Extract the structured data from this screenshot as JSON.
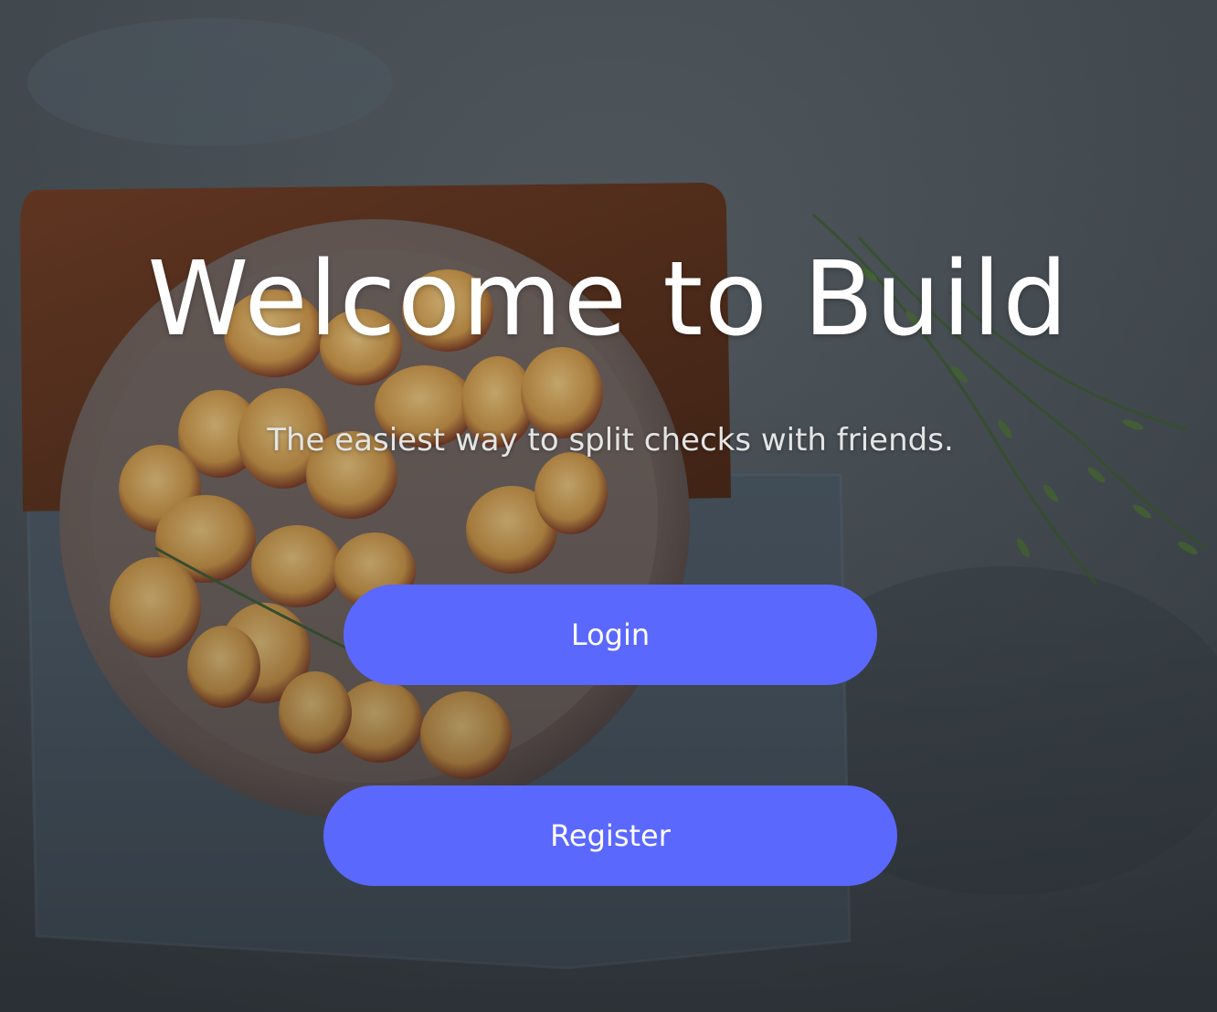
{
  "hero": {
    "title": "Welcome to Build",
    "subtitle": "The easiest way to split checks with friends."
  },
  "actions": {
    "login_label": "Login",
    "register_label": "Register"
  },
  "background": {
    "image": "food-table-photo",
    "description_icons": [
      "roasted-potatoes-bowl",
      "wooden-board",
      "linen-napkin",
      "herb-sprigs"
    ]
  },
  "colors": {
    "accent": "#5b68fd",
    "text": "#ffffff",
    "subtitle_text": "#e4e4e4",
    "background": "#4a5157"
  }
}
